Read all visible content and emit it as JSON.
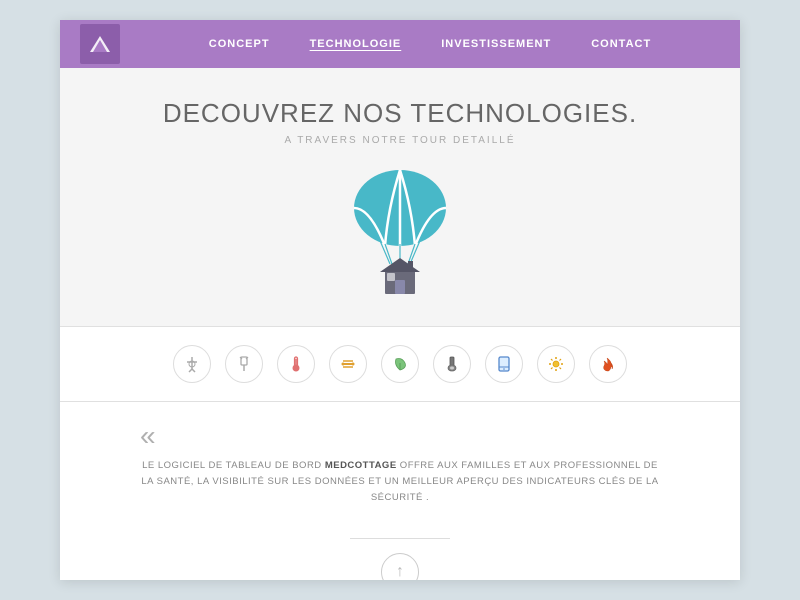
{
  "nav": {
    "logo_alt": "MedCottage Logo",
    "links": [
      {
        "id": "concept",
        "label": "CONCEPT",
        "active": false
      },
      {
        "id": "technologie",
        "label": "TECHNOLOGIE",
        "active": true
      },
      {
        "id": "investissement",
        "label": "INVESTISSEMENT",
        "active": false
      },
      {
        "id": "contact",
        "label": "CONTACT",
        "active": false
      }
    ]
  },
  "hero": {
    "title": "DECOUVREZ NOS TECHNOLOGIES.",
    "subtitle": "A TRAVERS NOTRE TOUR DETAILLÉ"
  },
  "icons": [
    {
      "id": "antenna-icon",
      "glyph": "📡",
      "label": "antenna"
    },
    {
      "id": "plug-icon",
      "glyph": "🔌",
      "label": "plug"
    },
    {
      "id": "gauge-icon",
      "glyph": "🌡",
      "label": "thermometer"
    },
    {
      "id": "medical-icon",
      "glyph": "🩺",
      "label": "medical"
    },
    {
      "id": "leaf-icon",
      "glyph": "🌿",
      "label": "leaf"
    },
    {
      "id": "flashlight-icon",
      "glyph": "🔦",
      "label": "flashlight"
    },
    {
      "id": "tablet-icon",
      "glyph": "📱",
      "label": "tablet"
    },
    {
      "id": "sun-icon",
      "glyph": "🌟",
      "label": "sun"
    },
    {
      "id": "fire-icon",
      "glyph": "🔥",
      "label": "fire"
    }
  ],
  "quote": {
    "mark": "«",
    "text_prefix": "LE LOGICIEL DE TABLEAU DE BORD ",
    "brand": "MEDCOTTAGE",
    "text_suffix": " OFFRE AUX FAMILLES ET AUX PROFESSIONNEL DE LA SANTÉ, LA VISIBILITÉ SUR LES DONNÉES ET UN MEILLEUR APERÇU DES INDICATEURS CLÉS DE LA SÉCURITÉ ."
  },
  "bottom": {
    "arrow_symbol": "↑"
  },
  "colors": {
    "nav_bg": "#a97bc5",
    "nav_logo_bg": "#8c5eaa",
    "accent": "#48b8c8"
  }
}
